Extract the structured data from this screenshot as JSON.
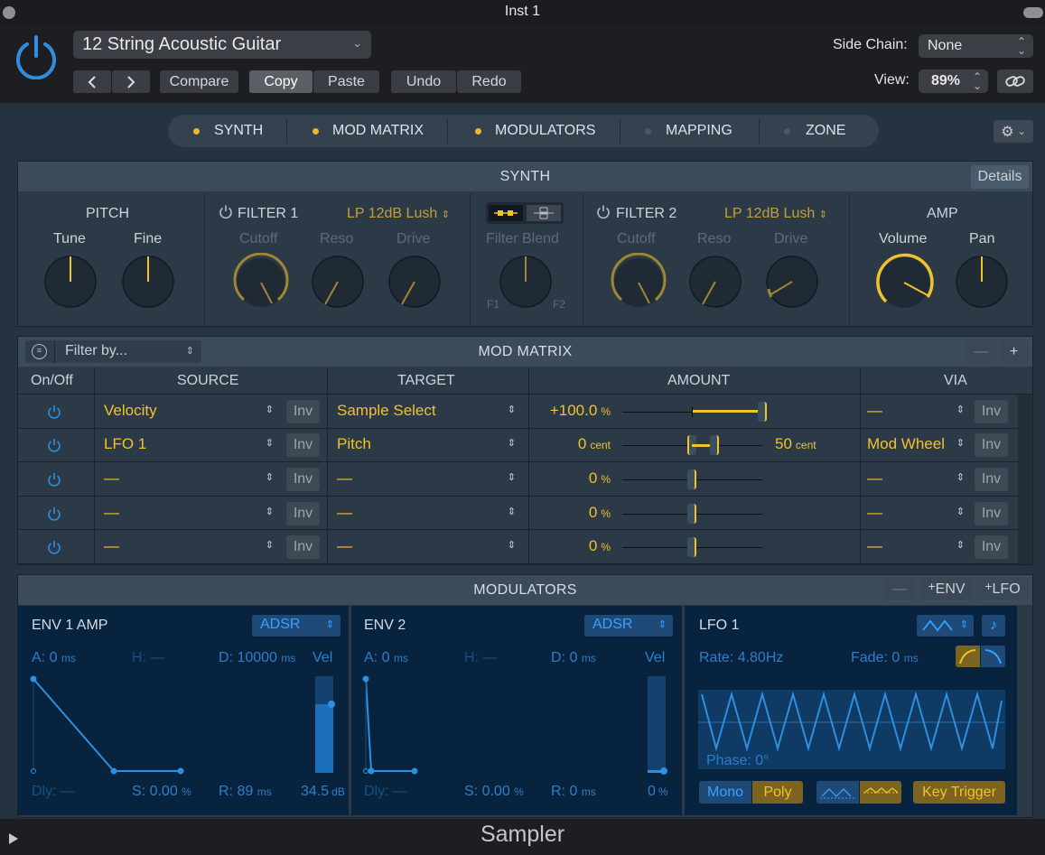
{
  "window": {
    "title": "Inst 1",
    "footer": "Sampler"
  },
  "preset": {
    "name": "12 String Acoustic Guitar"
  },
  "toolbar": {
    "compare": "Compare",
    "copy": "Copy",
    "paste": "Paste",
    "undo": "Undo",
    "redo": "Redo"
  },
  "side_chain": {
    "label": "Side Chain:",
    "value": "None"
  },
  "view": {
    "label": "View:",
    "value": "89%"
  },
  "tabs": [
    {
      "label": "SYNTH",
      "active": true
    },
    {
      "label": "MOD MATRIX",
      "active": true
    },
    {
      "label": "MODULATORS",
      "active": true
    },
    {
      "label": "MAPPING",
      "active": false
    },
    {
      "label": "ZONE",
      "active": false
    }
  ],
  "synth": {
    "title": "SYNTH",
    "details": "Details",
    "pitch": {
      "title": "PITCH",
      "tune": "Tune",
      "fine": "Fine"
    },
    "filter1": {
      "title": "FILTER 1",
      "type": "LP 12dB Lush",
      "cutoff": "Cutoff",
      "reso": "Reso",
      "drive": "Drive"
    },
    "blend": {
      "title": "Filter Blend",
      "f1": "F1",
      "f2": "F2"
    },
    "filter2": {
      "title": "FILTER 2",
      "type": "LP 12dB Lush",
      "cutoff": "Cutoff",
      "reso": "Reso",
      "drive": "Drive"
    },
    "amp": {
      "title": "AMP",
      "volume": "Volume",
      "pan": "Pan"
    }
  },
  "mod_matrix": {
    "title": "MOD MATRIX",
    "filter_placeholder": "Filter by...",
    "columns": {
      "onoff": "On/Off",
      "source": "SOURCE",
      "target": "TARGET",
      "amount": "AMOUNT",
      "via": "VIA"
    },
    "inv": "Inv",
    "rows": [
      {
        "source": "Velocity",
        "target": "Sample Select",
        "amount": "+100.0",
        "unit": "%",
        "via": "—",
        "via_amount": "",
        "via_unit": ""
      },
      {
        "source": "LFO 1",
        "target": "Pitch",
        "amount": "0",
        "unit": "cent",
        "via": "Mod Wheel",
        "via_amount": "50",
        "via_unit": "cent"
      },
      {
        "source": "—",
        "target": "—",
        "amount": "0",
        "unit": "%",
        "via": "—",
        "via_amount": "",
        "via_unit": ""
      },
      {
        "source": "—",
        "target": "—",
        "amount": "0",
        "unit": "%",
        "via": "—",
        "via_amount": "",
        "via_unit": ""
      },
      {
        "source": "—",
        "target": "—",
        "amount": "0",
        "unit": "%",
        "via": "—",
        "via_amount": "",
        "via_unit": ""
      }
    ]
  },
  "modulators": {
    "title": "MODULATORS",
    "minus": "—",
    "add_env": "ENV",
    "add_lfo": "LFO",
    "env1": {
      "title": "ENV 1 AMP",
      "mode": "ADSR",
      "a_label": "A:",
      "a": "0",
      "a_unit": "ms",
      "h": "H: —",
      "d_label": "D:",
      "d": "10000",
      "d_unit": "ms",
      "vel": "Vel",
      "dly": "Dly: —",
      "s_label": "S:",
      "s": "0.00",
      "s_unit": "%",
      "r_label": "R:",
      "r": "89",
      "r_unit": "ms",
      "vel_value": "34.5",
      "vel_unit": "dB"
    },
    "env2": {
      "title": "ENV 2",
      "mode": "ADSR",
      "a_label": "A:",
      "a": "0",
      "a_unit": "ms",
      "h": "H: —",
      "d_label": "D:",
      "d": "0",
      "d_unit": "ms",
      "vel": "Vel",
      "dly": "Dly: —",
      "s_label": "S:",
      "s": "0.00",
      "s_unit": "%",
      "r_label": "R:",
      "r": "0",
      "r_unit": "ms",
      "vel_value": "0",
      "vel_unit": "%"
    },
    "lfo1": {
      "title": "LFO 1",
      "rate": "Rate: 4.80Hz",
      "fade_label": "Fade:",
      "fade": "0",
      "fade_unit": "ms",
      "phase": "Phase: 0°",
      "mono": "Mono",
      "poly": "Poly",
      "key_trigger": "Key Trigger"
    }
  },
  "colors": {
    "accent": "#f0c22c",
    "blue": "#2d8fe0",
    "panel": "#2b3845"
  }
}
